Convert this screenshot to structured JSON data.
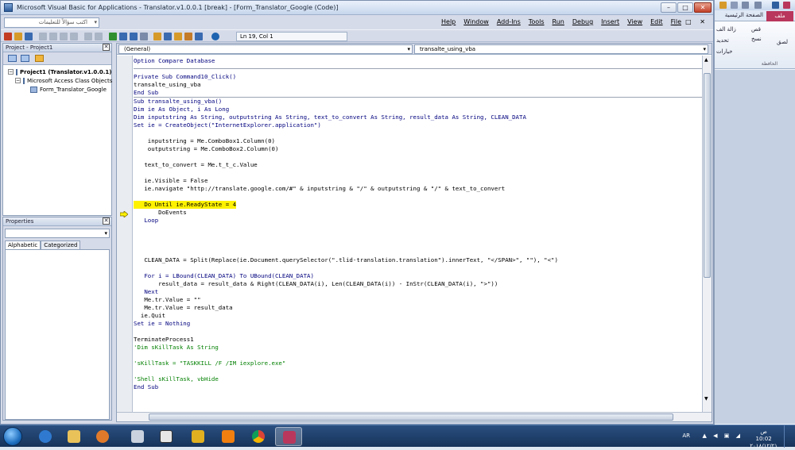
{
  "window": {
    "title": "Microsoft Visual Basic for Applications - Translator.v1.0.0.1 [break] - [Form_Translator_Google (Code)]",
    "min": "–",
    "max": "□",
    "close": "✕"
  },
  "menubar": {
    "ask_placeholder": "اكتب سؤالاً للتعليمات",
    "ask_arrow": "▾",
    "items": [
      "Help",
      "Window",
      "Add-Ins",
      "Tools",
      "Run",
      "Debug",
      "Insert",
      "View",
      "Edit",
      "File"
    ],
    "mdi_controls": "_ □ ✕"
  },
  "toolbar": {
    "position": "Ln 19, Col 1"
  },
  "project_pane": {
    "title": "Project - Project1",
    "close": "✕",
    "tree": [
      {
        "label": "Project1 (Translator.v1.0.0.1)",
        "level": 0,
        "expander": "−",
        "bold": true
      },
      {
        "label": "Microsoft Access Class Objects",
        "level": 1,
        "expander": "−",
        "bold": false
      },
      {
        "label": "Form_Translator_Google",
        "level": 2,
        "expander": "",
        "bold": false
      }
    ]
  },
  "properties_pane": {
    "title": "Properties",
    "close": "✕",
    "combo_arrow": "▾",
    "tabs": [
      "Alphabetic",
      "Categorized"
    ]
  },
  "code_window": {
    "object_dropdown": "(General)",
    "proc_dropdown": "transalte_using_vba",
    "dropdown_arrow": "▾",
    "lines": [
      {
        "t": "Option Compare Database",
        "c": "kw"
      },
      {
        "t": "",
        "c": "sep"
      },
      {
        "t": "Private Sub Command10_Click()",
        "c": "kw"
      },
      {
        "t": "transalte_using_vba",
        "c": ""
      },
      {
        "t": "End Sub",
        "c": "kw"
      },
      {
        "t": "Sub transalte_using_vba()",
        "c": "kw"
      },
      {
        "t": "Dim ie As Object, i As Long",
        "c": "kw"
      },
      {
        "t": "Dim inputstring As String, outputstring As String, text_to_convert As String, result_data As String, CLEAN_DATA",
        "c": "kw"
      },
      {
        "t": "Set ie = CreateObject(\"InternetExplorer.application\")",
        "c": "kw"
      },
      {
        "t": "",
        "c": ""
      },
      {
        "t": "    inputstring = Me.ComboBox1.Column(0)",
        "c": ""
      },
      {
        "t": "    outputstring = Me.ComboBox2.Column(0)",
        "c": ""
      },
      {
        "t": "",
        "c": ""
      },
      {
        "t": "   text_to_convert = Me.t_t_c.Value",
        "c": ""
      },
      {
        "t": "",
        "c": ""
      },
      {
        "t": "   ie.Visible = False",
        "c": ""
      },
      {
        "t": "   ie.navigate \"http://translate.google.com/#\" & inputstring & \"/\" & outputstring & \"/\" & text_to_convert",
        "c": ""
      },
      {
        "t": "",
        "c": ""
      },
      {
        "t": "   Do Until ie.ReadyState = 4",
        "c": "hl"
      },
      {
        "t": "       DoEvents",
        "c": ""
      },
      {
        "t": "   Loop",
        "c": "kw"
      },
      {
        "t": "",
        "c": ""
      },
      {
        "t": "",
        "c": ""
      },
      {
        "t": "",
        "c": ""
      },
      {
        "t": "",
        "c": ""
      },
      {
        "t": "   CLEAN_DATA = Split(Replace(ie.Document.querySelector(\".tlid-translation.translation\").innerText, \"</SPAN>\", \"\"), \"<\")",
        "c": ""
      },
      {
        "t": "",
        "c": ""
      },
      {
        "t": "   For i = LBound(CLEAN_DATA) To UBound(CLEAN_DATA)",
        "c": "kw"
      },
      {
        "t": "       result_data = result_data & Right(CLEAN_DATA(i), Len(CLEAN_DATA(i)) - InStr(CLEAN_DATA(i), \">\"))",
        "c": ""
      },
      {
        "t": "   Next",
        "c": "kw"
      },
      {
        "t": "   Me.tr.Value = \"\"",
        "c": ""
      },
      {
        "t": "   Me.tr.Value = result_data",
        "c": ""
      },
      {
        "t": "  ie.Quit",
        "c": ""
      },
      {
        "t": "Set ie = Nothing",
        "c": "kw"
      },
      {
        "t": "",
        "c": ""
      },
      {
        "t": "TerminateProcess1",
        "c": ""
      },
      {
        "t": "'Dim sKillTask As String",
        "c": "cm"
      },
      {
        "t": "",
        "c": ""
      },
      {
        "t": "'sKillTask = \"TASKKILL /F /IM iexplore.exe\"",
        "c": "cm"
      },
      {
        "t": "",
        "c": ""
      },
      {
        "t": "'Shell sKillTask, vbHide",
        "c": "cm"
      },
      {
        "t": "End Sub",
        "c": "kw"
      }
    ]
  },
  "access": {
    "file_tab": "ملف",
    "home_tab": "الصفحة الرئيسية",
    "ribbon_cut": "قص",
    "ribbon_copy": "نسخ",
    "ribbon_paste": "لصق",
    "ribbon_filter1": "زالة الف",
    "ribbon_filter2": "تحديد",
    "ribbon_filter3": "خيارات",
    "clipboard_group": "الحافظة"
  },
  "taskbar": {
    "lang": "AR",
    "tray_icons": "▲ ◀ ▣ ◢",
    "ampm": "ص",
    "time": "10:02",
    "date": "٢٠١٨/١٢/٢١"
  },
  "colors": {
    "keyword": "#00007f",
    "comment": "#007f00",
    "highlight": "#fff200",
    "access_accent": "#b9375c"
  }
}
